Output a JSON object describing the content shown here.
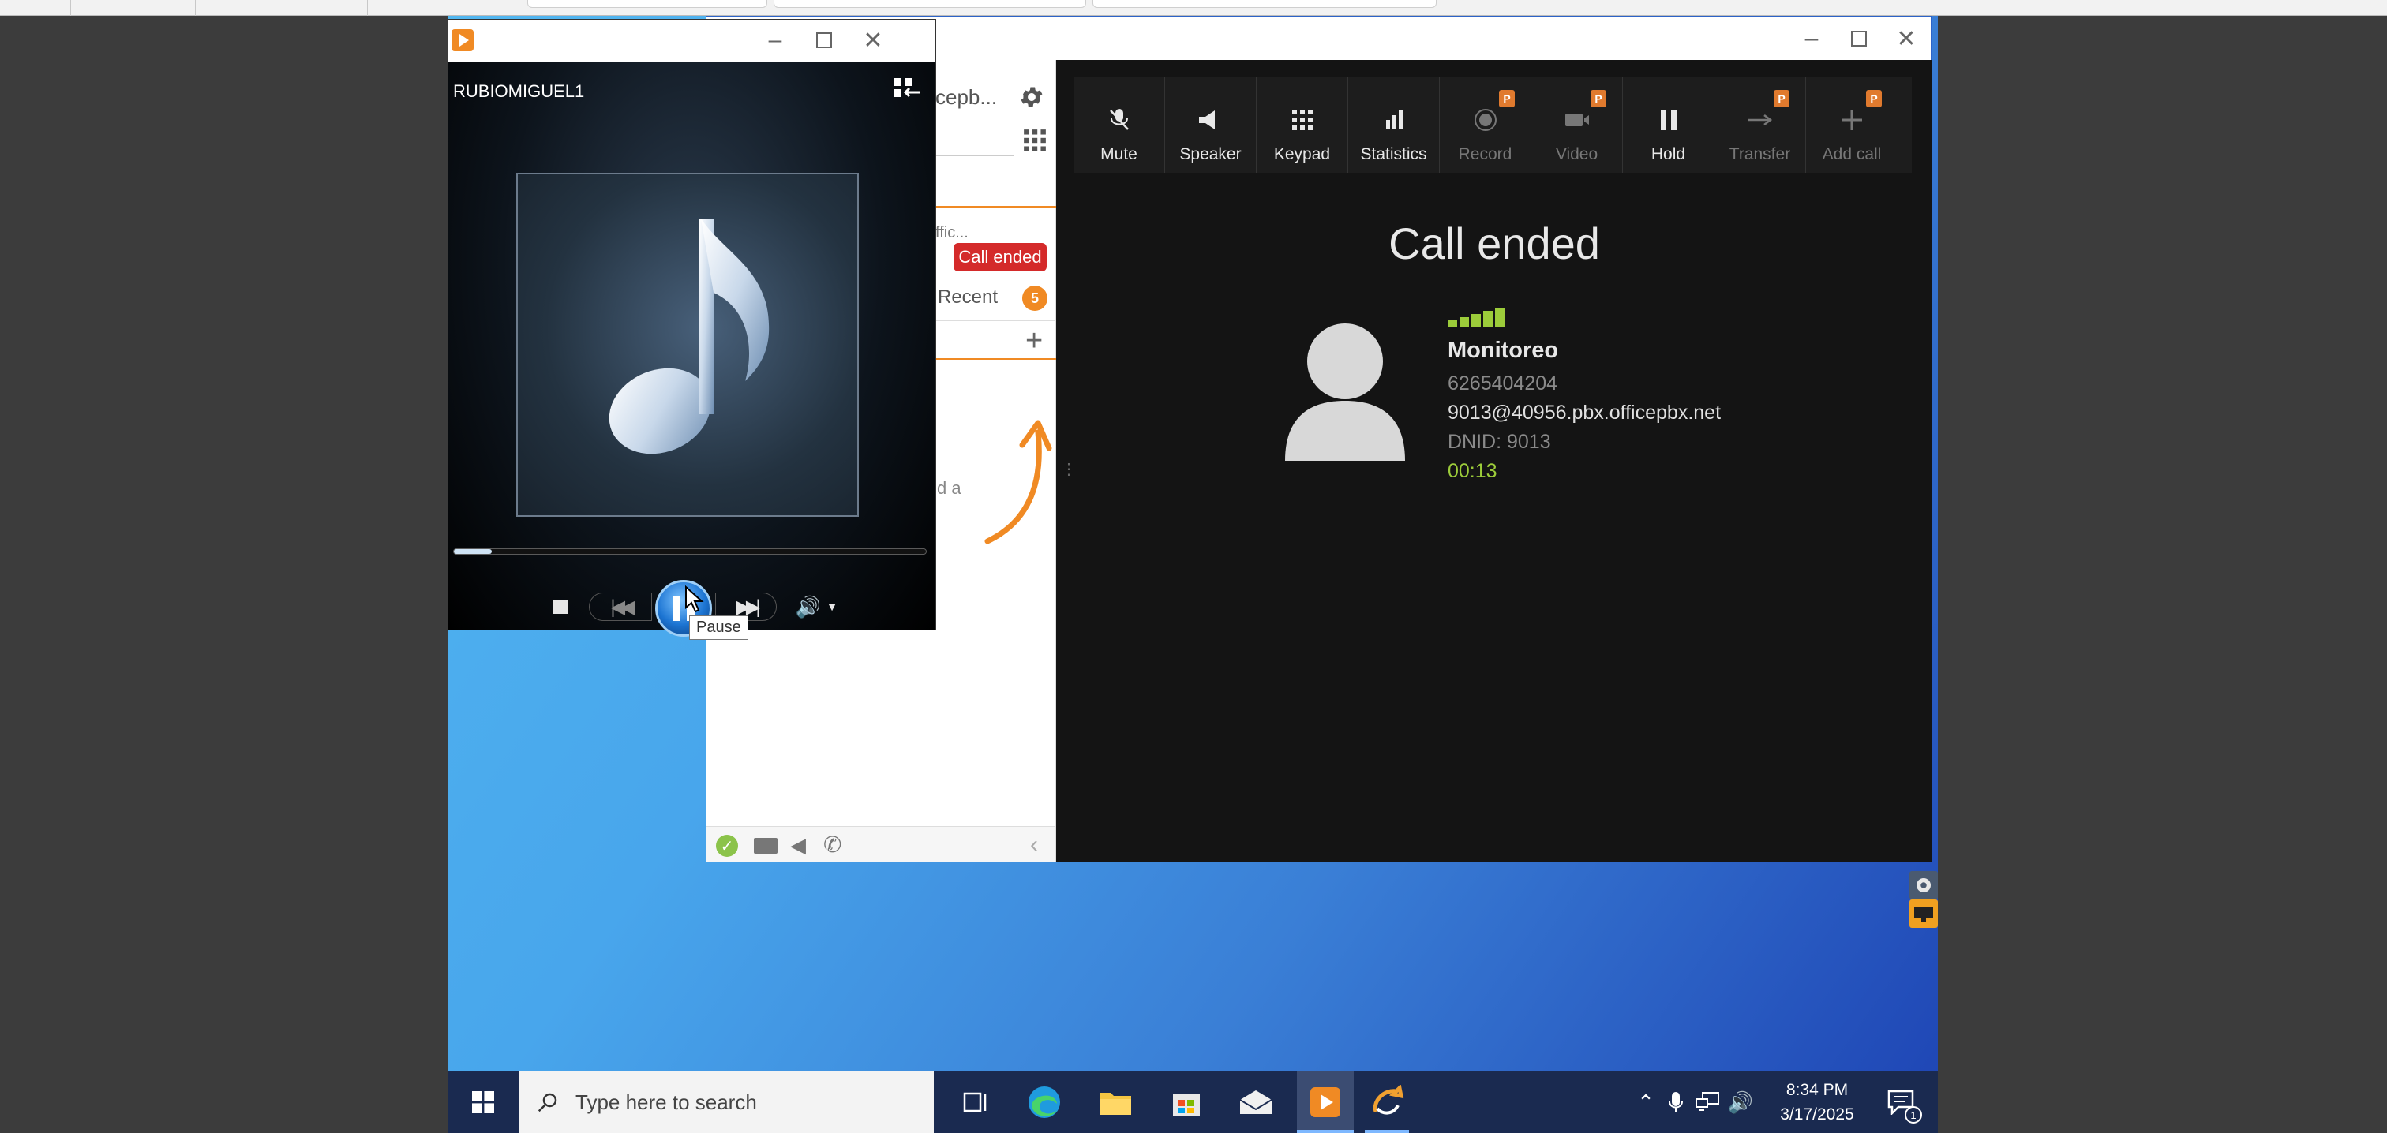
{
  "player": {
    "track": "RUBIOMIGUEL1",
    "tooltip": "Pause",
    "progress_fraction": 0.08,
    "icons": [
      "switch-to-library-icon",
      "stop-icon",
      "previous-icon",
      "pause-icon",
      "next-icon",
      "volume-icon"
    ]
  },
  "phone_left": {
    "account_fragment": "cepb...",
    "line_fragment": "ffic...",
    "call_status_badge": "Call ended",
    "recent_label": "Recent",
    "recent_count": "5",
    "hint_fragment": "d a"
  },
  "toolbar": {
    "buttons": [
      {
        "label": "Mute",
        "icon": "microphone-off-icon",
        "enabled": true,
        "premium": false
      },
      {
        "label": "Speaker",
        "icon": "speaker-icon",
        "enabled": true,
        "premium": false
      },
      {
        "label": "Keypad",
        "icon": "keypad-icon",
        "enabled": true,
        "premium": false
      },
      {
        "label": "Statistics",
        "icon": "bar-chart-icon",
        "enabled": true,
        "premium": false
      },
      {
        "label": "Record",
        "icon": "record-icon",
        "enabled": false,
        "premium": true
      },
      {
        "label": "Video",
        "icon": "video-icon",
        "enabled": false,
        "premium": true
      },
      {
        "label": "Hold",
        "icon": "pause-icon",
        "enabled": true,
        "premium": false
      },
      {
        "label": "Transfer",
        "icon": "transfer-arrow-icon",
        "enabled": false,
        "premium": true
      },
      {
        "label": "Add call",
        "icon": "plus-icon",
        "enabled": false,
        "premium": true
      }
    ],
    "premium_badge": "P"
  },
  "call": {
    "status": "Call ended",
    "contact_name": "Monitoreo",
    "number": "6265404204",
    "sip_address": "9013@40956.pbx.officepbx.net",
    "dnid": "DNID: 9013",
    "duration": "00:13",
    "signal_bars": 5
  },
  "taskbar": {
    "search_placeholder": "Type here to search",
    "time": "8:34 PM",
    "date": "3/17/2025",
    "notification_count": "1"
  },
  "colors": {
    "call_ended_red": "#d42a2a",
    "accent_orange": "#f08a24",
    "duration_green": "#9ccc3a",
    "dark_panel": "#141414"
  }
}
